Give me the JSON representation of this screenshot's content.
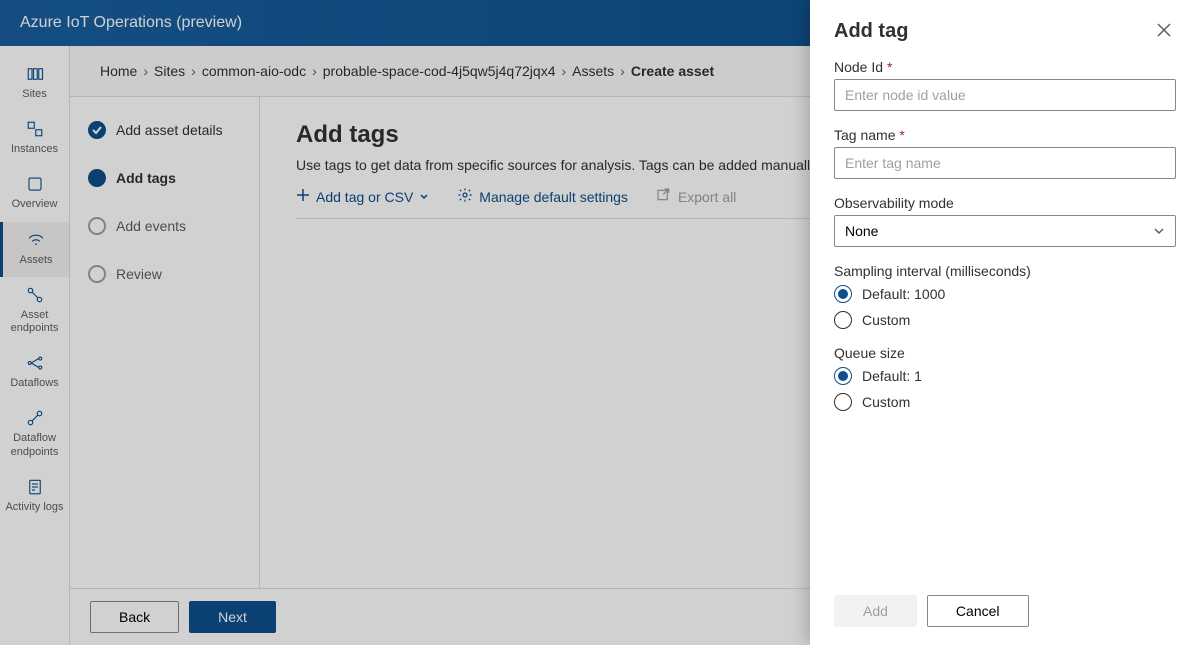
{
  "header": {
    "title": "Azure IoT Operations (preview)"
  },
  "nav": {
    "items": [
      {
        "label": "Sites",
        "icon": "library"
      },
      {
        "label": "Instances",
        "icon": "instances"
      },
      {
        "label": "Overview",
        "icon": "overview"
      },
      {
        "label": "Assets",
        "icon": "assets",
        "active": true
      },
      {
        "label": "Asset endpoints",
        "icon": "asset-endpoints"
      },
      {
        "label": "Dataflows",
        "icon": "dataflows"
      },
      {
        "label": "Dataflow endpoints",
        "icon": "dataflow-endpoints"
      },
      {
        "label": "Activity logs",
        "icon": "activity-logs"
      }
    ]
  },
  "breadcrumb": {
    "items": [
      "Home",
      "Sites",
      "common-aio-odc",
      "probable-space-cod-4j5qw5j4q72jqx4",
      "Assets"
    ],
    "current": "Create asset"
  },
  "steps": {
    "items": [
      {
        "label": "Add asset details",
        "state": "completed"
      },
      {
        "label": "Add tags",
        "state": "active"
      },
      {
        "label": "Add events",
        "state": "pending"
      },
      {
        "label": "Review",
        "state": "pending"
      }
    ]
  },
  "main": {
    "title": "Add tags",
    "intro": "Use tags to get data from specific sources for analysis. Tags can be added manually or uploaded with a CSV file.",
    "toolbar": {
      "add_tag_csv": "Add tag or CSV",
      "manage_defaults": "Manage default settings",
      "export_all": "Export all"
    }
  },
  "footer": {
    "back": "Back",
    "next": "Next"
  },
  "panel": {
    "title": "Add tag",
    "fields": {
      "node_id": {
        "label": "Node Id",
        "placeholder": "Enter node id value"
      },
      "tag_name": {
        "label": "Tag name",
        "placeholder": "Enter tag name"
      },
      "observability_mode": {
        "label": "Observability mode",
        "value": "None"
      },
      "sampling_interval": {
        "label": "Sampling interval (milliseconds)",
        "default": "Default: 1000",
        "custom": "Custom"
      },
      "queue_size": {
        "label": "Queue size",
        "default": "Default: 1",
        "custom": "Custom"
      }
    },
    "footer": {
      "add": "Add",
      "cancel": "Cancel"
    }
  }
}
